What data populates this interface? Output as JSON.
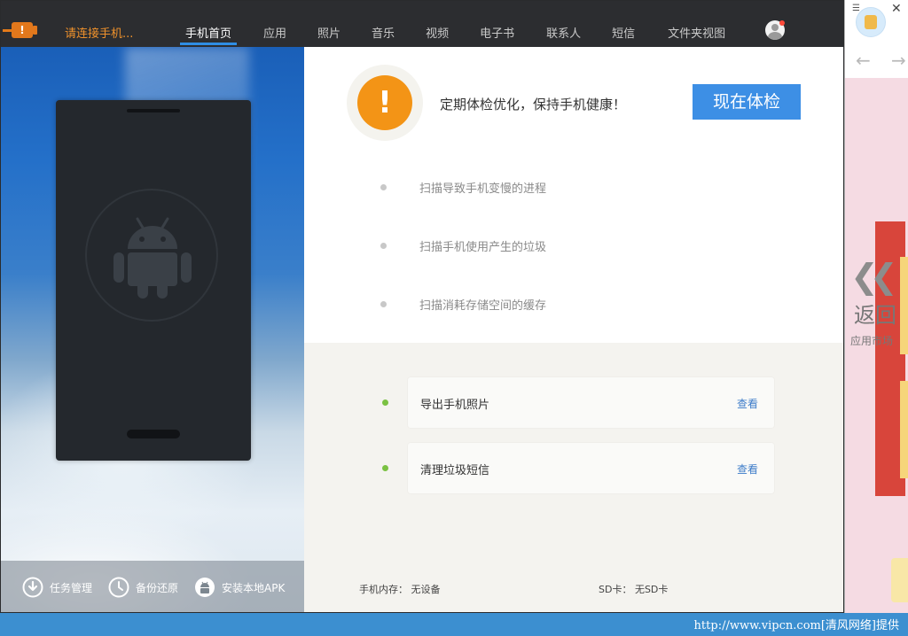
{
  "header": {
    "connect_status": "请连接手机...",
    "tabs": [
      {
        "label": "手机首页",
        "active": true
      },
      {
        "label": "应用"
      },
      {
        "label": "照片"
      },
      {
        "label": "音乐"
      },
      {
        "label": "视频"
      },
      {
        "label": "电子书"
      },
      {
        "label": "联系人"
      },
      {
        "label": "短信"
      },
      {
        "label": "文件夹视图"
      }
    ],
    "plug_icon_glyph": "!",
    "accent_color": "#2f8de4"
  },
  "left_panel": {
    "tools": [
      {
        "label": "任务管理",
        "icon": "download-icon"
      },
      {
        "label": "备份还原",
        "icon": "clock-icon"
      },
      {
        "label": "安装本地APK",
        "icon": "android-icon"
      }
    ]
  },
  "health": {
    "warning_glyph": "!",
    "message": "定期体检优化，保持手机健康！",
    "button_label": "现在体检",
    "scan_items": [
      "扫描导致手机变慢的进程",
      "扫描手机使用产生的垃圾",
      "扫描消耗存储空间的缓存"
    ]
  },
  "tasks": [
    {
      "label": "导出手机照片",
      "action": "查看"
    },
    {
      "label": "清理垃圾短信",
      "action": "查看"
    }
  ],
  "storage": {
    "phone_memory": "手机内存：  无设备",
    "sd_card": "SD卡：  无SD卡"
  },
  "side_window": {
    "menu_glyph": "☰",
    "close_glyph": "✕",
    "back_glyph": "←",
    "forward_glyph": "→",
    "chevron_glyph": "❮❮",
    "back_label": "返回",
    "market_label": "应用市场"
  },
  "watermark": "http://www.vipcn.com[清风网络]提供"
}
